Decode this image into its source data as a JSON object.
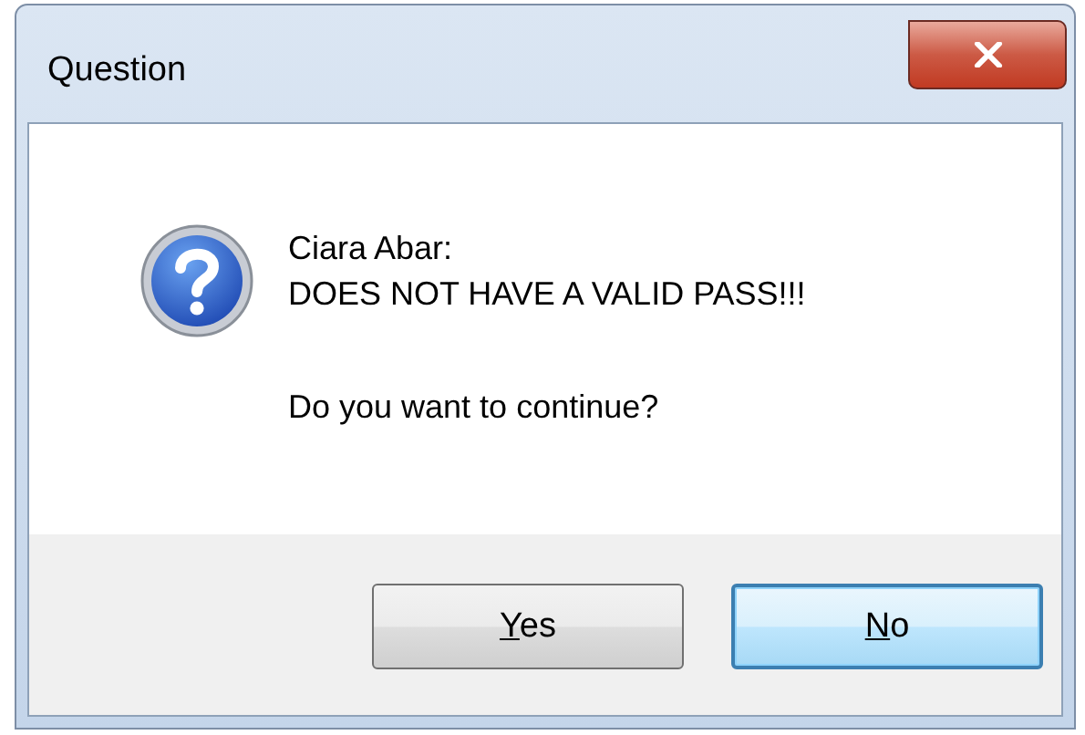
{
  "window": {
    "title": "Question"
  },
  "message": {
    "lines": [
      "Ciara Abar:",
      "DOES NOT HAVE A VALID PASS!!!"
    ],
    "question": "Do you want to continue?"
  },
  "buttons": [
    {
      "mnemonic": "Y",
      "rest": "es",
      "default": false
    },
    {
      "mnemonic": "N",
      "rest": "o",
      "default": true
    }
  ]
}
